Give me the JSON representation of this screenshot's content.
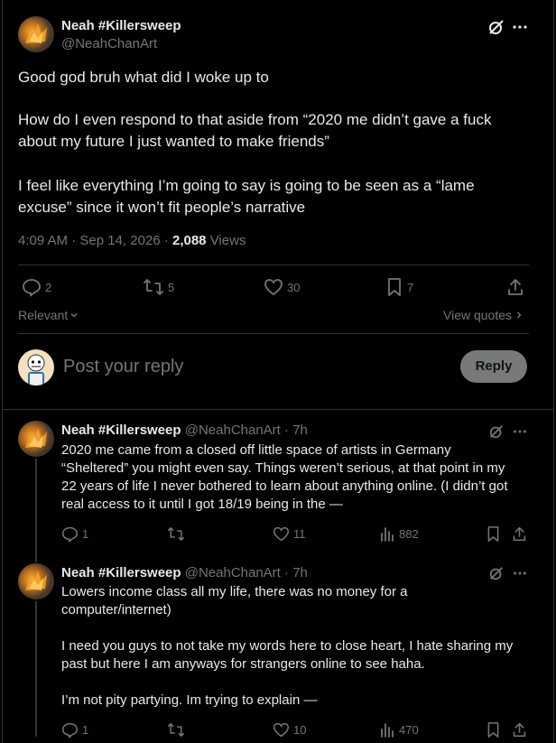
{
  "main_post": {
    "author_name": "Neah #Killersweep",
    "author_handle": "@NeahChanArt",
    "paragraphs": [
      "Good god bruh what did I woke up to",
      "How do I even respond to that aside from “2020 me didn’t gave a fuck about my future I just wanted to make friends”",
      "I feel like everything I’m going to say is going to be seen as a “lame excuse” since it won’t fit people’s narrative"
    ],
    "time": "4:09 AM",
    "date": "Sep 14, 2026",
    "views_count": "2,088",
    "views_label": "Views",
    "replies": "2",
    "reposts": "5",
    "likes": "30",
    "bookmarks": "7",
    "sort_label": "Relevant",
    "view_quotes_label": "View quotes"
  },
  "composer": {
    "placeholder": "Post your reply",
    "reply_button": "Reply"
  },
  "replies": [
    {
      "author_name": "Neah #Killersweep",
      "author_handle": "@NeahChanArt",
      "time_ago": "7h",
      "lines": [
        "2020 me came from a closed off little space of artists in Germany",
        "“Sheltered” you might even say. Things weren’t serious, at that point in my",
        "22 years of life I never bothered to learn about anything online. (I didn’t got",
        "real access to it until I got 18/19 being in the —"
      ],
      "replies": "1",
      "reposts": "",
      "likes": "11",
      "views": "882"
    },
    {
      "author_name": "Neah #Killersweep",
      "author_handle": "@NeahChanArt",
      "time_ago": "7h",
      "paragraphs": [
        "Lowers income class all my life, there was no money for a computer/internet)",
        "I need you guys to not take my words here to close heart, I hate sharing my past but here I am anyways for strangers online to see haha.",
        "I’m not pity partying. Im trying to explain —"
      ],
      "replies": "1",
      "reposts": "",
      "likes": "10",
      "views": "470"
    }
  ],
  "icons": [
    "grok-icon",
    "more-icon",
    "reply-icon",
    "repost-icon",
    "like-icon",
    "bookmark-icon",
    "share-icon",
    "views-icon",
    "chevron-down-icon",
    "chevron-right-icon"
  ],
  "colors": {
    "background": "#000000",
    "text": "#e7e9ea",
    "muted": "#71767b",
    "border": "#2f3336",
    "reply_button_bg": "#787a7a"
  }
}
